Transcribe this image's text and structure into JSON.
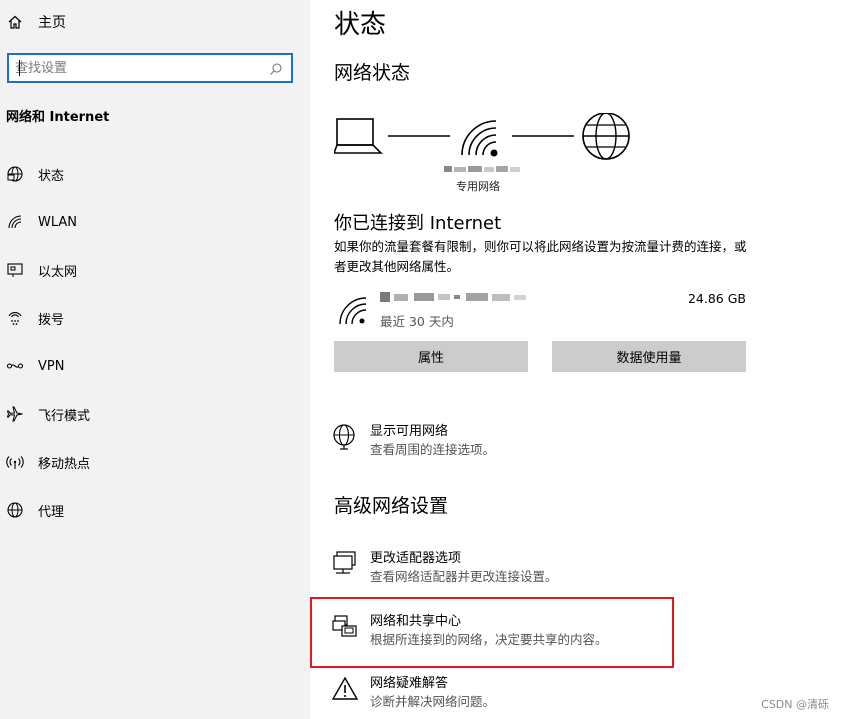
{
  "sidebar": {
    "home_label": "主页",
    "search_placeholder": "查找设置",
    "section_title": "网络和 Internet",
    "items": [
      {
        "label": "状态",
        "icon": "status-globe-icon"
      },
      {
        "label": "WLAN",
        "icon": "wifi-icon"
      },
      {
        "label": "以太网",
        "icon": "ethernet-icon"
      },
      {
        "label": "拨号",
        "icon": "dialup-icon"
      },
      {
        "label": "VPN",
        "icon": "vpn-icon"
      },
      {
        "label": "飞行模式",
        "icon": "airplane-icon"
      },
      {
        "label": "移动热点",
        "icon": "hotspot-icon"
      },
      {
        "label": "代理",
        "icon": "proxy-globe-icon"
      }
    ]
  },
  "main": {
    "page_title": "状态",
    "network_status_heading": "网络状态",
    "network_type": "专用网络",
    "connected_title": "你已连接到 Internet",
    "connected_desc": "如果你的流量套餐有限制，则你可以将此网络设置为按流量计费的连接，或者更改其他网络属性。",
    "connection_period": "最近 30 天内",
    "connection_usage": "24.86 GB",
    "properties_button": "属性",
    "data_usage_button": "数据使用量",
    "show_networks": {
      "title": "显示可用网络",
      "desc": "查看周围的连接选项。"
    },
    "advanced_heading": "高级网络设置",
    "adapter_options": {
      "title": "更改适配器选项",
      "desc": "查看网络适配器并更改连接设置。"
    },
    "sharing_center": {
      "title": "网络和共享中心",
      "desc": "根据所连接到的网络，决定要共享的内容。"
    },
    "troubleshooter": {
      "title": "网络疑难解答",
      "desc": "诊断并解决网络问题。"
    }
  },
  "watermark": "CSDN @清砾",
  "colors": {
    "sidebar_bg": "#f2f2f2",
    "search_border": "#1a73c8",
    "button_bg": "#cccccc",
    "highlight": "#e0191e"
  }
}
